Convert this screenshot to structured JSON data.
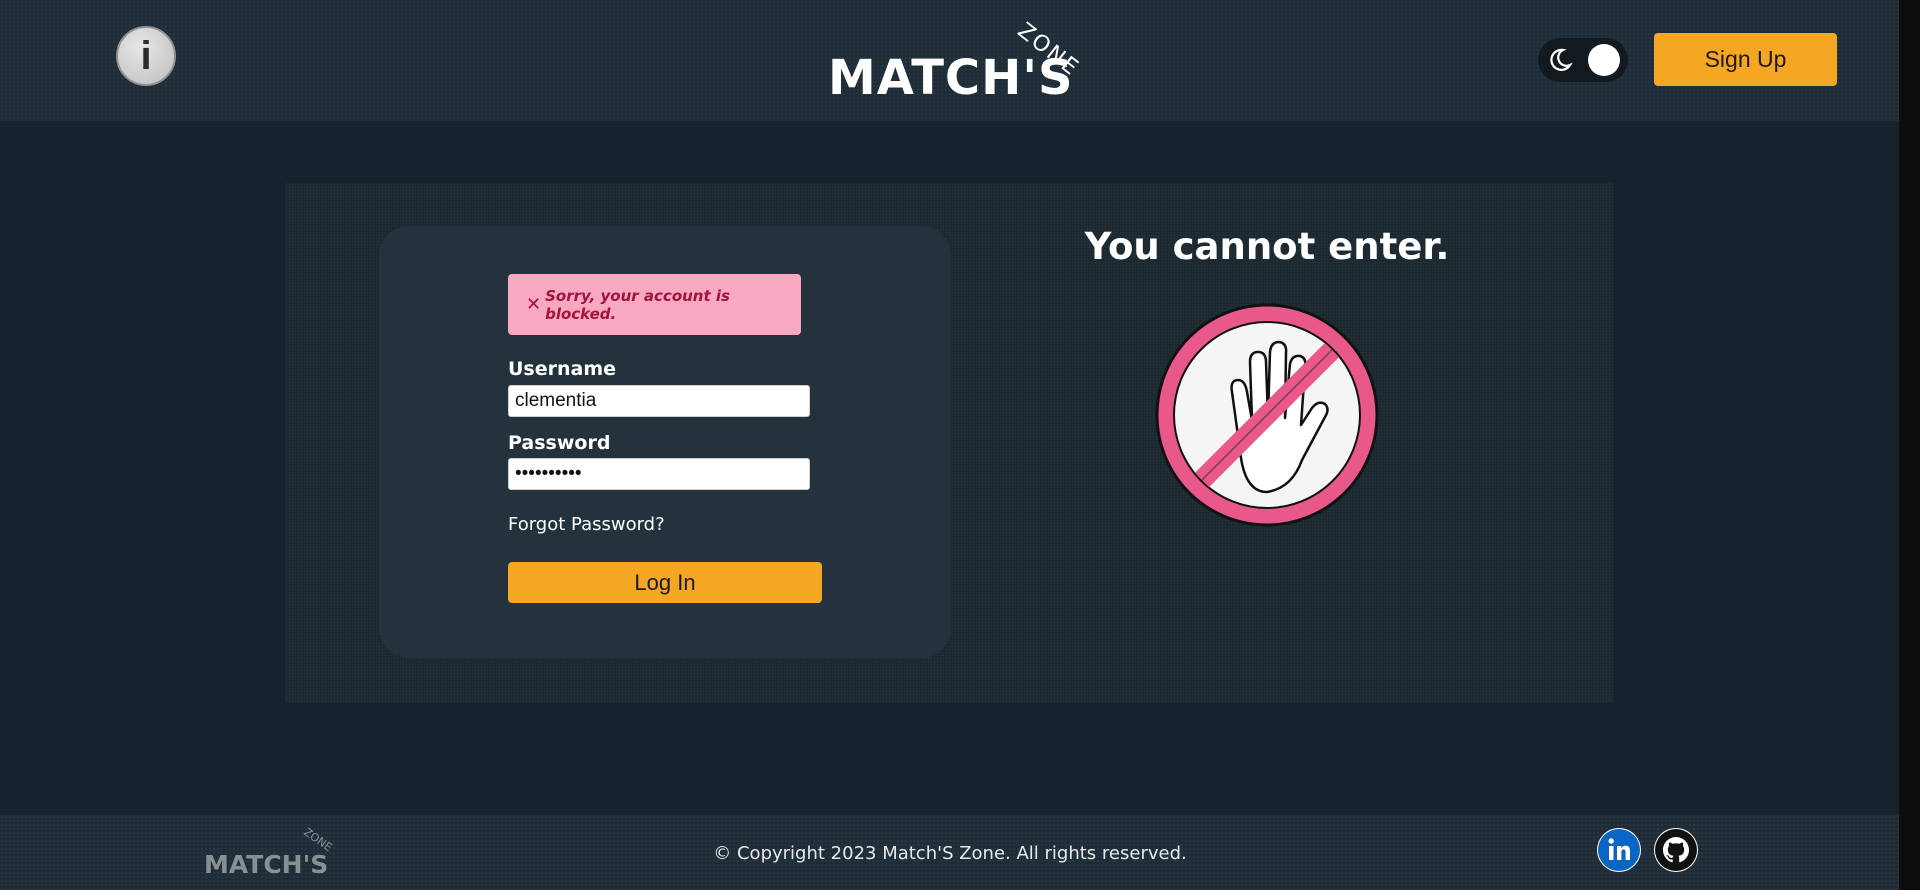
{
  "header": {
    "logo_main": "MATCH'S",
    "logo_sub": "ZONE",
    "info_icon": "info-icon",
    "theme_icon": "moon-icon",
    "signup_label": "Sign Up"
  },
  "login": {
    "error_message": "Sorry, your account is blocked.",
    "error_icon": "close-icon",
    "username_label": "Username",
    "username_value": "clementia",
    "password_label": "Password",
    "password_value": "••••••••••",
    "forgot_label": "Forgot Password?",
    "login_label": "Log In"
  },
  "side": {
    "title": "You cannot enter.",
    "illustration": "stop-hand-icon"
  },
  "footer": {
    "logo_main": "MATCH'S",
    "logo_sub": "ZONE",
    "copyright": "© Copyright 2023 Match'S Zone. All rights reserved.",
    "social": [
      "linkedin-icon",
      "github-icon"
    ]
  },
  "colors": {
    "accent": "#f5a623",
    "error_bg": "#f8a9c1",
    "error_text": "#a2143c",
    "stop_ring": "#e8588a",
    "background": "#18222e"
  }
}
